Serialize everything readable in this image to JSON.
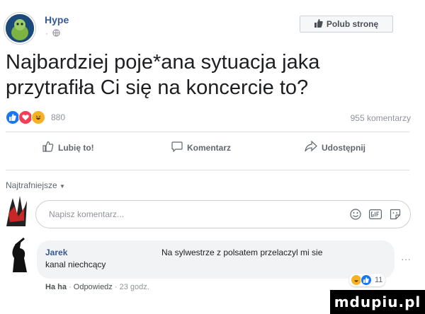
{
  "header": {
    "page_name": "Hype",
    "meta_dot": "·",
    "globe_icon": "globe-icon",
    "like_page_label": "Polub stronę"
  },
  "post": {
    "text": "Najbardziej poje*ana sytuacja jaka przytrafiła Ci się na koncercie to?",
    "reactions_count": "880",
    "comments_count": "955 komentarzy",
    "reaction_icons": [
      "like-reaction-icon",
      "love-reaction-icon",
      "haha-reaction-icon"
    ]
  },
  "actions": {
    "like_label": "Lubię to!",
    "comment_label": "Komentarz",
    "share_label": "Udostępnij"
  },
  "comments_section": {
    "sort_label": "Najtrafniejsze",
    "input_placeholder": "Napisz komentarz...",
    "input_icons": [
      "emoji-icon",
      "gif-icon",
      "sticker-icon"
    ]
  },
  "comment": {
    "author": "Jarek",
    "text_line1": "Na sylwestrze z polsatem przelaczyl mi sie",
    "text_line2": "kanal niechcący",
    "reaction_count": "11",
    "reply_prefix": "Ha ha",
    "reply_label": "Odpowiedz",
    "time": "23 godz."
  },
  "watermark": {
    "text": "mdupiu.pl"
  },
  "colors": {
    "link": "#365899",
    "muted": "#90949c",
    "like_blue": "#1877f2",
    "love_red": "#f33e58",
    "haha_yellow": "#f7b125"
  }
}
